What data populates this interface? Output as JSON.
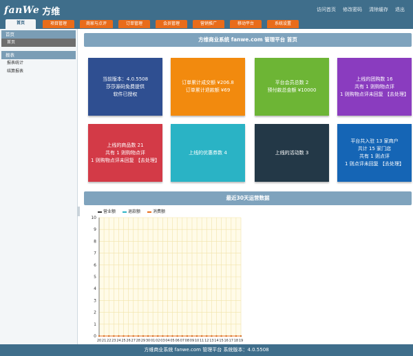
{
  "header": {
    "logo_en": "fanWe",
    "logo_cn": "方维",
    "links": [
      "访问首页",
      "修改密码",
      "清除缓存",
      "退出"
    ]
  },
  "nav": {
    "items": [
      "首页",
      "项目管理",
      "商家与点评",
      "订单管理",
      "会员管理",
      "营销推广",
      "移动平台",
      "系统设置"
    ]
  },
  "sidebar": {
    "section1": "首页",
    "section1_items": [
      "首页"
    ],
    "section2": "报表",
    "section2_items": [
      "报表统计",
      "结算报表"
    ]
  },
  "main": {
    "title": "方维商业系统 fanwe.com 管理平台 首页",
    "chart_title": "最近30天运营数据"
  },
  "cards": [
    {
      "lines": [
        "当前版本：4.0.5508",
        "莎莎源码免费提供",
        "软件已授权"
      ],
      "color": "#2f4f91"
    },
    {
      "lines": [
        "订单累计成交额 ¥206.8",
        "订单累计退款额 ¥69"
      ],
      "color": "#f28a0e"
    },
    {
      "lines": [
        "平台会员总数 2",
        "预付款总金额 ¥10000"
      ],
      "color": "#6db535"
    },
    {
      "lines": [
        "上线的团购数 16",
        "共有 1 则购物点评",
        "1 则购物点评未回复 【去处理】"
      ],
      "color": "#8a3cbf"
    },
    {
      "lines": [
        "上线的商品数 21",
        "共有 1 则购物点评",
        "1 则购物点评未回复 【去处理】"
      ],
      "color": "#d33a47"
    },
    {
      "lines": [
        "上线的优惠券数 4"
      ],
      "color": "#2ab3c5"
    },
    {
      "lines": [
        "上线的活动数 3"
      ],
      "color": "#233847"
    },
    {
      "lines": [
        "平台共入驻 13 家商户",
        "共计 15 家门店",
        "共有 1 则点评",
        "1 则点评未回复 【去处理】"
      ],
      "color": "#1565b5"
    }
  ],
  "footer": {
    "text": "方维商业系统 fanwe.com 管理平台 系统版本：4.0.5508"
  },
  "chart_data": {
    "type": "line",
    "title": "",
    "legend_placement": "top-left",
    "ylim": [
      0,
      10
    ],
    "y_ticks": [
      "0",
      "1",
      "2",
      "3",
      "4",
      "5",
      "6",
      "7",
      "8",
      "9",
      "10"
    ],
    "x_labels": [
      "20",
      "21",
      "22",
      "23",
      "24",
      "25",
      "26",
      "27",
      "28",
      "29",
      "30",
      "01",
      "02",
      "03",
      "04",
      "05",
      "06",
      "07",
      "08",
      "09",
      "10",
      "11",
      "12",
      "13",
      "14",
      "15",
      "16",
      "17",
      "18",
      "19"
    ],
    "grid": true,
    "series": [
      {
        "name": "营业额",
        "color": "#333333",
        "values": [
          0,
          0,
          0,
          0,
          0,
          0,
          0,
          0,
          0,
          0,
          0,
          0,
          0,
          0,
          0,
          0,
          0,
          0,
          0,
          0,
          0,
          0,
          0,
          0,
          0,
          0,
          0,
          0,
          0,
          0
        ]
      },
      {
        "name": "退款额",
        "color": "#2ab3c5",
        "values": [
          0,
          0,
          0,
          0,
          0,
          0,
          0,
          0,
          0,
          0,
          0,
          0,
          0,
          0,
          0,
          0,
          0,
          0,
          0,
          0,
          0,
          0,
          0,
          0,
          0,
          0,
          0,
          0,
          0,
          0
        ]
      },
      {
        "name": "消费额",
        "color": "#e96c1a",
        "values": [
          0,
          0,
          0,
          0,
          0,
          0,
          0,
          0,
          0,
          0,
          0,
          0,
          0,
          0,
          0,
          0,
          0,
          0,
          0,
          0,
          0,
          0,
          0,
          0,
          0,
          0,
          0,
          0,
          0,
          0
        ]
      }
    ]
  }
}
